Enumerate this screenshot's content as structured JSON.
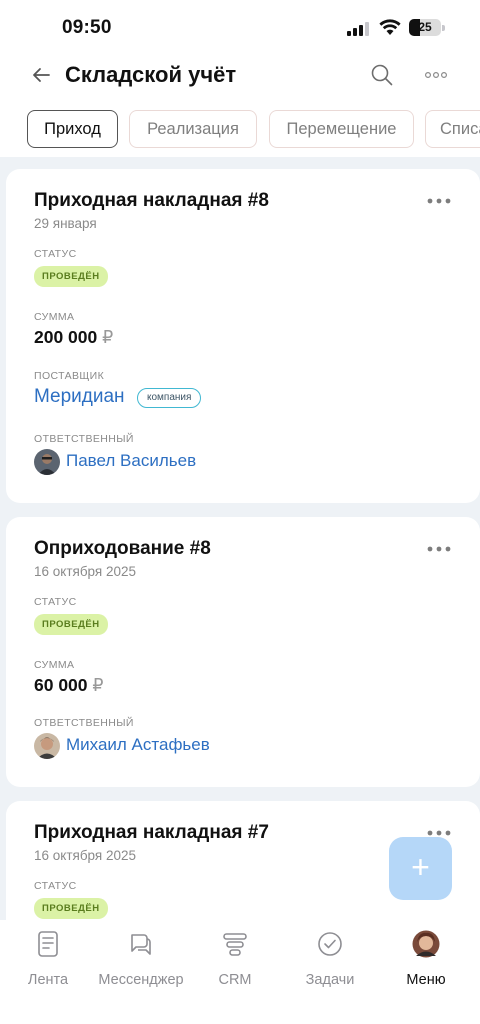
{
  "status_bar": {
    "time": "09:50",
    "battery": "25"
  },
  "header": {
    "title": "Складской учёт"
  },
  "tabs": [
    {
      "label": "Приход"
    },
    {
      "label": "Реализация"
    },
    {
      "label": "Перемещение"
    },
    {
      "label": "Списание"
    }
  ],
  "cards": [
    {
      "title": "Приходная накладная #8",
      "date": "29 января",
      "status_label": "СТАТУС",
      "status": "ПРОВЕДЁН",
      "amount_label": "СУММА",
      "amount": "200 000",
      "currency": "₽",
      "supplier_label": "ПОСТАВЩИК",
      "supplier": "Меридиан",
      "supplier_badge": "компания",
      "responsible_label": "ОТВЕТСТВЕННЫЙ",
      "responsible": "Павел Васильев"
    },
    {
      "title": "Оприходование #8",
      "date": "16 октября 2025",
      "status_label": "СТАТУС",
      "status": "ПРОВЕДЁН",
      "amount_label": "СУММА",
      "amount": "60 000",
      "currency": "₽",
      "responsible_label": "ОТВЕТСТВЕННЫЙ",
      "responsible": "Михаил Астафьев"
    },
    {
      "title": "Приходная накладная #7",
      "date": "16 октября 2025",
      "status_label": "СТАТУС",
      "status": "ПРОВЕДЁН"
    }
  ],
  "fab": {
    "icon": "plus-icon",
    "label": "+"
  },
  "bottom_nav": [
    {
      "label": "Лента",
      "icon": "feed-icon"
    },
    {
      "label": "Мессенджер",
      "icon": "messenger-icon"
    },
    {
      "label": "CRM",
      "icon": "crm-icon"
    },
    {
      "label": "Задачи",
      "icon": "tasks-icon"
    },
    {
      "label": "Меню",
      "icon": "menu-avatar",
      "active": true
    }
  ],
  "colors": {
    "accent_link": "#2d6fc2",
    "status_badge_bg": "#dbf2a6",
    "status_badge_text": "#5a7d1e",
    "company_badge_border": "#41b8d2",
    "fab_bg": "#b5d7f8",
    "page_bg": "#eef2f6"
  }
}
